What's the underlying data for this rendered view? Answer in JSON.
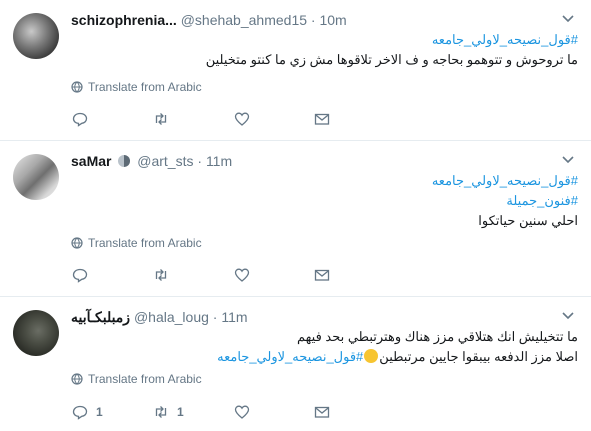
{
  "tweets": [
    {
      "name": "schizophrenia...",
      "handle": "@shehab_ahmed15",
      "dot": "·",
      "time": "10m",
      "lines": [
        {
          "text": "#قول_نصيحه_لاولي_جامعه",
          "kind": "hashtag"
        },
        {
          "text": "ما تروحوش و تتوهمو بحاجه و ف الاخر تلاقوها مش زي ما كنتو متخيلين",
          "kind": "plain"
        }
      ],
      "translate": "Translate from Arabic",
      "reply_count": "",
      "retweet_count": "",
      "like_count": ""
    },
    {
      "name": "saMar",
      "handle": "@art_sts",
      "dot": "·",
      "time": "11m",
      "lines": [
        {
          "text": "#قول_نصيحه_لاولي_جامعه",
          "kind": "hashtag"
        },
        {
          "text": "#فنون_جميلة",
          "kind": "hashtag"
        },
        {
          "text": "احلي سنين حياتكوا",
          "kind": "plain"
        }
      ],
      "translate": "Translate from Arabic",
      "reply_count": "",
      "retweet_count": "",
      "like_count": ""
    },
    {
      "name": "ﺯﻣﺒﻠﺒﻜـﺂﺑﻴﻪ",
      "handle": "@hala_loug",
      "dot": "·",
      "time": "11m",
      "lines": [
        {
          "text": "ما تتخيليش انك هتلاقي مزز هناك وهترتبطي بحد فيهم",
          "kind": "plain"
        },
        {
          "text": "اصلا مزز الدفعه بيبقوا جايين مرتبطين",
          "kind": "mixed",
          "hashtag": "#قول_نصيحه_لاولي_جامعه"
        }
      ],
      "translate": "Translate from Arabic",
      "reply_count": "1",
      "retweet_count": "1",
      "like_count": ""
    }
  ],
  "icons": {
    "globe": "globe-icon",
    "reply": "reply-icon",
    "retweet": "retweet-icon",
    "like": "heart-icon",
    "dm": "envelope-icon",
    "caret": "chevron-down-icon",
    "moon": "moon-icon",
    "emoji": "laughing-emoji-icon"
  },
  "colors": {
    "hashtag": "#1b95e0",
    "secondary": "#657786",
    "text": "#14171a",
    "divider": "#e6ecf0"
  }
}
